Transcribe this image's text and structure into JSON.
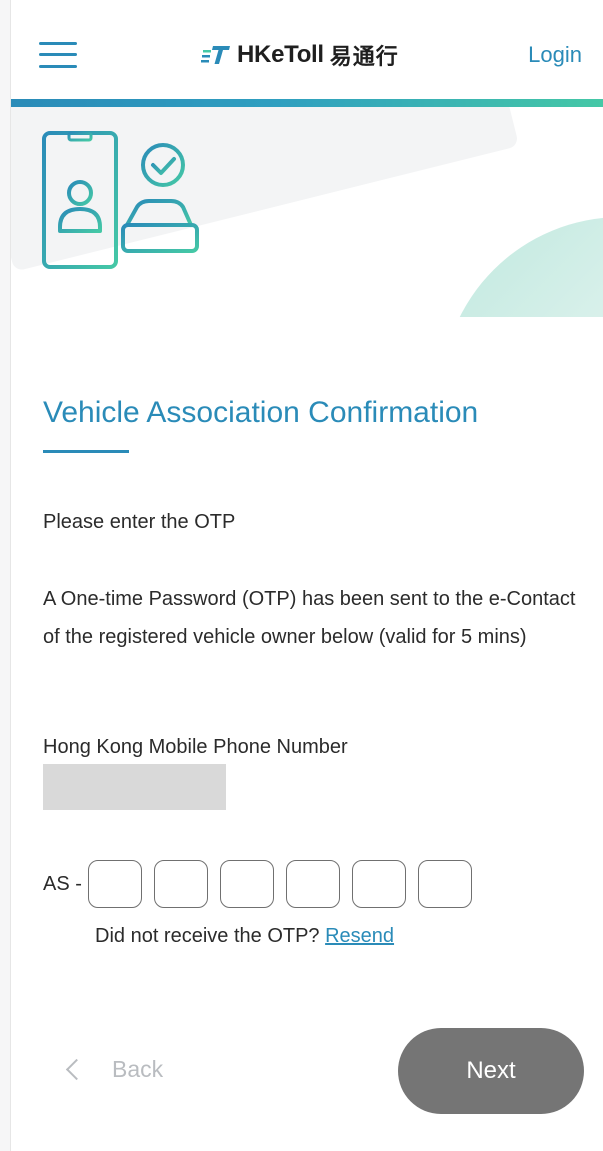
{
  "header": {
    "logo_mark": "eT",
    "logo_name": "HKeToll",
    "logo_cn": "易通行",
    "login": "Login"
  },
  "colors": {
    "accent": "#2a8bb8",
    "accent_green": "#45c8a6",
    "button_gray": "#757575",
    "masked_gray": "#d9d9d9"
  },
  "icons": {
    "menu": "hamburger-icon",
    "hero": "phone-user-car-check-icon",
    "back": "chevron-left-icon"
  },
  "page": {
    "title": "Vehicle Association Confirmation",
    "instruction": "Please enter the OTP",
    "otp_info": "A One-time Password (OTP) has been sent to the e-Contact of the registered vehicle owner below (valid for 5 mins)",
    "phone_label": "Hong Kong Mobile Phone Number",
    "otp_prefix": "AS -",
    "otp_digits": [
      "",
      "",
      "",
      "",
      "",
      ""
    ],
    "resend_prompt": "Did not receive the OTP? ",
    "resend_link": "Resend"
  },
  "footer": {
    "back": "Back",
    "next": "Next"
  }
}
